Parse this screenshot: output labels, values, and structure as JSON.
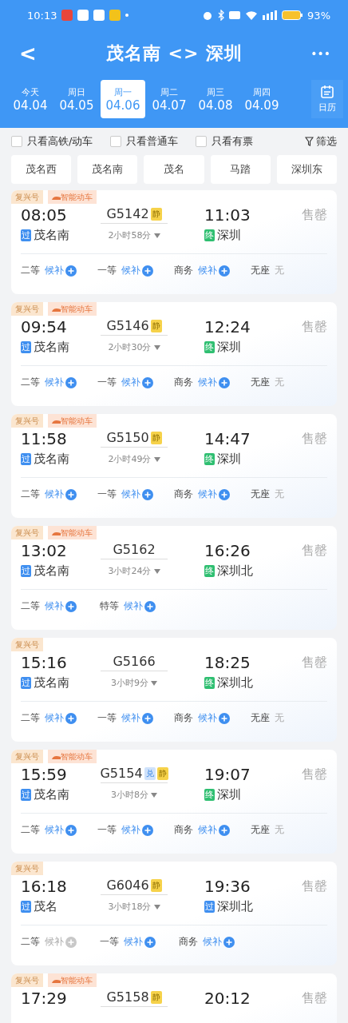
{
  "status_bar": {
    "time": "10:13",
    "battery": "93%"
  },
  "header": {
    "title": "茂名南 <> 深圳",
    "back": "<",
    "more": "•••"
  },
  "dates": [
    {
      "weekday": "今天",
      "date": "04.04",
      "selected": false
    },
    {
      "weekday": "周日",
      "date": "04.05",
      "selected": false
    },
    {
      "weekday": "周一",
      "date": "04.06",
      "selected": true
    },
    {
      "weekday": "周二",
      "date": "04.07",
      "selected": false
    },
    {
      "weekday": "周三",
      "date": "04.08",
      "selected": false
    },
    {
      "weekday": "周四",
      "date": "04.09",
      "selected": false
    }
  ],
  "calendar_button": "日历",
  "filters": [
    {
      "label": "只看高铁/动车",
      "checked": false
    },
    {
      "label": "只看普通车",
      "checked": false
    },
    {
      "label": "只看有票",
      "checked": false
    }
  ],
  "filter_button": "筛选",
  "stations": [
    "茂名西",
    "茂名南",
    "茂名",
    "马踏",
    "深圳东"
  ],
  "trains": [
    {
      "tags": [
        "复兴号",
        "智能动车"
      ],
      "depart": "08:05",
      "train_no": "G5142",
      "badges": [
        {
          "text": "静",
          "kind": "quiet"
        }
      ],
      "arrive": "11:03",
      "status": "售罄",
      "from": {
        "badge": "过",
        "kind": "pass",
        "name": "茂名南"
      },
      "duration": "2小时58分",
      "to": {
        "badge": "终",
        "kind": "terminal",
        "name": "深圳"
      },
      "seats": [
        {
          "class": "二等",
          "value": "候补",
          "kind": "waitlist",
          "available": true
        },
        {
          "class": "一等",
          "value": "候补",
          "kind": "waitlist",
          "available": true
        },
        {
          "class": "商务",
          "value": "候补",
          "kind": "waitlist",
          "available": true
        },
        {
          "class": "无座",
          "value": "无",
          "kind": "plain",
          "available": false
        }
      ]
    },
    {
      "tags": [
        "复兴号",
        "智能动车"
      ],
      "depart": "09:54",
      "train_no": "G5146",
      "badges": [
        {
          "text": "静",
          "kind": "quiet"
        }
      ],
      "arrive": "12:24",
      "status": "售罄",
      "from": {
        "badge": "过",
        "kind": "pass",
        "name": "茂名南"
      },
      "duration": "2小时30分",
      "to": {
        "badge": "终",
        "kind": "terminal",
        "name": "深圳"
      },
      "seats": [
        {
          "class": "二等",
          "value": "候补",
          "kind": "waitlist",
          "available": true
        },
        {
          "class": "一等",
          "value": "候补",
          "kind": "waitlist",
          "available": true
        },
        {
          "class": "商务",
          "value": "候补",
          "kind": "waitlist",
          "available": true
        },
        {
          "class": "无座",
          "value": "无",
          "kind": "plain",
          "available": false
        }
      ]
    },
    {
      "tags": [
        "复兴号",
        "智能动车"
      ],
      "depart": "11:58",
      "train_no": "G5150",
      "badges": [
        {
          "text": "静",
          "kind": "quiet"
        }
      ],
      "arrive": "14:47",
      "status": "售罄",
      "from": {
        "badge": "过",
        "kind": "pass",
        "name": "茂名南"
      },
      "duration": "2小时49分",
      "to": {
        "badge": "终",
        "kind": "terminal",
        "name": "深圳"
      },
      "seats": [
        {
          "class": "二等",
          "value": "候补",
          "kind": "waitlist",
          "available": true
        },
        {
          "class": "一等",
          "value": "候补",
          "kind": "waitlist",
          "available": true
        },
        {
          "class": "商务",
          "value": "候补",
          "kind": "waitlist",
          "available": true
        },
        {
          "class": "无座",
          "value": "无",
          "kind": "plain",
          "available": false
        }
      ]
    },
    {
      "tags": [
        "复兴号",
        "智能动车"
      ],
      "depart": "13:02",
      "train_no": "G5162",
      "arrive": "16:26",
      "status": "售罄",
      "from": {
        "badge": "过",
        "kind": "pass",
        "name": "茂名南"
      },
      "duration": "3小时24分",
      "to": {
        "badge": "终",
        "kind": "terminal",
        "name": "深圳北"
      },
      "seats": [
        {
          "class": "二等",
          "value": "候补",
          "kind": "waitlist",
          "available": true
        },
        {
          "class": "特等",
          "value": "候补",
          "kind": "waitlist",
          "available": true
        }
      ]
    },
    {
      "tags": [
        "复兴号"
      ],
      "depart": "15:16",
      "train_no": "G5166",
      "arrive": "18:25",
      "status": "售罄",
      "from": {
        "badge": "过",
        "kind": "pass",
        "name": "茂名南"
      },
      "duration": "3小时9分",
      "to": {
        "badge": "终",
        "kind": "terminal",
        "name": "深圳北"
      },
      "seats": [
        {
          "class": "二等",
          "value": "候补",
          "kind": "waitlist",
          "available": true
        },
        {
          "class": "一等",
          "value": "候补",
          "kind": "waitlist",
          "available": true
        },
        {
          "class": "商务",
          "value": "候补",
          "kind": "waitlist",
          "available": true
        },
        {
          "class": "无座",
          "value": "无",
          "kind": "plain",
          "available": false
        }
      ]
    },
    {
      "tags": [
        "复兴号",
        "智能动车"
      ],
      "depart": "15:59",
      "train_no": "G5154",
      "badges": [
        {
          "text": "兑",
          "kind": "exchange"
        },
        {
          "text": "静",
          "kind": "quiet"
        }
      ],
      "arrive": "19:07",
      "status": "售罄",
      "from": {
        "badge": "过",
        "kind": "pass",
        "name": "茂名南"
      },
      "duration": "3小时8分",
      "to": {
        "badge": "终",
        "kind": "terminal",
        "name": "深圳"
      },
      "seats": [
        {
          "class": "二等",
          "value": "候补",
          "kind": "waitlist",
          "available": true
        },
        {
          "class": "一等",
          "value": "候补",
          "kind": "waitlist",
          "available": true
        },
        {
          "class": "商务",
          "value": "候补",
          "kind": "waitlist",
          "available": true
        },
        {
          "class": "无座",
          "value": "无",
          "kind": "plain",
          "available": false
        }
      ]
    },
    {
      "tags": [
        "复兴号"
      ],
      "depart": "16:18",
      "train_no": "G6046",
      "badges": [
        {
          "text": "静",
          "kind": "quiet"
        }
      ],
      "arrive": "19:36",
      "status": "售罄",
      "from": {
        "badge": "过",
        "kind": "pass",
        "name": "茂名"
      },
      "duration": "3小时18分",
      "to": {
        "badge": "过",
        "kind": "pass",
        "name": "深圳北"
      },
      "seats": [
        {
          "class": "二等",
          "value": "候补",
          "kind": "waitlist",
          "available": false
        },
        {
          "class": "一等",
          "value": "候补",
          "kind": "waitlist",
          "available": true
        },
        {
          "class": "商务",
          "value": "候补",
          "kind": "waitlist",
          "available": true
        }
      ]
    },
    {
      "tags": [
        "复兴号",
        "智能动车"
      ],
      "depart": "17:29",
      "train_no": "G5158",
      "badges": [
        {
          "text": "静",
          "kind": "quiet"
        }
      ],
      "arrive": "20:12",
      "status": "售罄"
    }
  ]
}
